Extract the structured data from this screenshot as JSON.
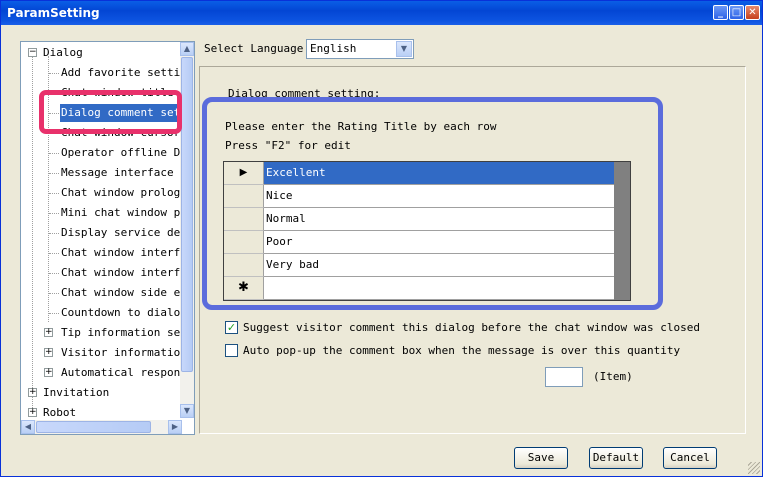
{
  "window": {
    "title": "ParamSetting",
    "controls": [
      "minimize",
      "maximize",
      "close"
    ]
  },
  "tree": {
    "items": [
      {
        "label": "Dialog",
        "expander": "−"
      },
      {
        "label": "Add favorite setting"
      },
      {
        "label": "Chat window title se"
      },
      {
        "label": "Dialog comment setti",
        "selected": true
      },
      {
        "label": "Chat window cursor fo"
      },
      {
        "label": "Operator offline Dis"
      },
      {
        "label": "Message interface se"
      },
      {
        "label": "Chat window prologue"
      },
      {
        "label": "Mini chat window pro"
      },
      {
        "label": "Display service depa"
      },
      {
        "label": "Chat window interfac"
      },
      {
        "label": "Chat window interfac"
      },
      {
        "label": "Chat window side edg"
      },
      {
        "label": "Countdown to dialog"
      },
      {
        "label": "Tip information sett",
        "expander": "+"
      },
      {
        "label": "Visitor information",
        "expander": "+"
      },
      {
        "label": "Automatical response",
        "expander": "+"
      },
      {
        "label": "Invitation",
        "expander": "+"
      },
      {
        "label": "Robot",
        "expander": "+"
      }
    ],
    "scroll": {
      "up": "▲",
      "down": "▼",
      "left": "◀",
      "right": "▶"
    }
  },
  "language": {
    "label": "Select Language",
    "value": "English",
    "arrow": "▼"
  },
  "section": {
    "title": "Dialog comment setting:",
    "instruction1": "Please enter the Rating Title by each row",
    "instruction2": "Press \"F2\" for edit"
  },
  "grid": {
    "rows": [
      {
        "marker": "▶",
        "value": "Excellent",
        "selected": true
      },
      {
        "marker": "",
        "value": "Nice"
      },
      {
        "marker": "",
        "value": "Normal"
      },
      {
        "marker": "",
        "value": "Poor"
      },
      {
        "marker": "",
        "value": "Very bad"
      },
      {
        "marker": "✱",
        "value": ""
      }
    ]
  },
  "options": {
    "suggest": {
      "label": "Suggest visitor comment this dialog before the chat window was closed",
      "checked": true,
      "mark": "✓"
    },
    "auto_popup": {
      "label": "Auto pop-up the comment box when the message is over this quantity",
      "checked": false
    },
    "quantity_value": "",
    "quantity_unit": "(Item)"
  },
  "buttons": {
    "save": "Save",
    "default": "Default",
    "cancel": "Cancel"
  },
  "colors": {
    "titlebar": "#0a5ee6",
    "selection": "#316ac5",
    "annotation_pink": "#e8316b",
    "annotation_blue": "#5b6cdc"
  }
}
